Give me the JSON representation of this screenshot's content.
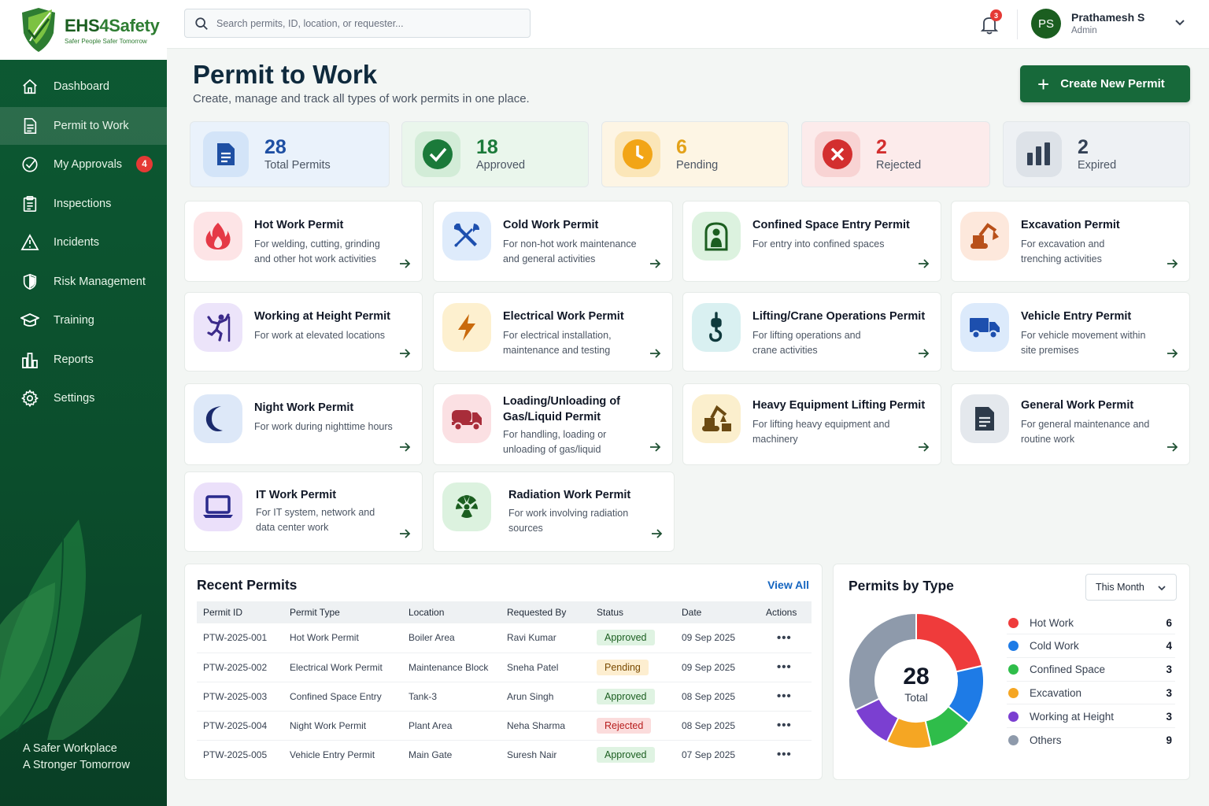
{
  "brand": {
    "name_a": "EHS",
    "name_b": "4Safety",
    "tagline_small": "Safer People  Safer Tomorrow"
  },
  "sidebar": {
    "items": [
      {
        "label": "Dashboard",
        "icon": "home-icon"
      },
      {
        "label": "Permit to Work",
        "icon": "document-icon",
        "active": true
      },
      {
        "label": "My Approvals",
        "icon": "check-circle-icon",
        "badge": "4"
      },
      {
        "label": "Inspections",
        "icon": "clipboard-icon"
      },
      {
        "label": "Incidents",
        "icon": "warning-icon"
      },
      {
        "label": "Risk Management",
        "icon": "shield-icon"
      },
      {
        "label": "Training",
        "icon": "graduation-cap-icon"
      },
      {
        "label": "Reports",
        "icon": "bar-chart-icon"
      },
      {
        "label": "Settings",
        "icon": "gear-icon"
      }
    ],
    "footer_line1": "A Safer Workplace",
    "footer_line2": "A Stronger Tomorrow"
  },
  "topbar": {
    "search_placeholder": "Search permits, ID, location, or requester...",
    "notification_count": "3",
    "user_initials": "PS",
    "user_name": "Prathamesh S",
    "user_role": "Admin"
  },
  "page": {
    "title": "Permit to Work",
    "subtitle": "Create, manage and track all types of work permits in one place.",
    "create_label": "Create New Permit"
  },
  "stats": [
    {
      "value": "28",
      "label": "Total Permits",
      "color": "#1e4fa3",
      "bg": "#eaf2fb",
      "icon": "document-icon"
    },
    {
      "value": "18",
      "label": "Approved",
      "color": "#1b7a3a",
      "bg": "#eaf6ec",
      "icon": "check-circle-icon"
    },
    {
      "value": "6",
      "label": "Pending",
      "color": "#e3a21a",
      "bg": "#fdf5e4",
      "icon": "clock-icon"
    },
    {
      "value": "2",
      "label": "Rejected",
      "color": "#d32f2f",
      "bg": "#fcebeb",
      "icon": "x-circle-icon"
    },
    {
      "value": "2",
      "label": "Expired",
      "color": "#334155",
      "bg": "#eef1f4",
      "icon": "bar-chart-icon"
    }
  ],
  "permit_types": [
    {
      "title": "Hot Work Permit",
      "desc": "For welding, cutting, grinding and other hot work activities",
      "icon": "flame-icon"
    },
    {
      "title": "Cold Work Permit",
      "desc": "For non-hot work maintenance and general activities",
      "icon": "tools-icon"
    },
    {
      "title": "Confined Space Entry Permit",
      "desc": "For entry into confined spaces",
      "icon": "confined-space-icon"
    },
    {
      "title": "Excavation Permit",
      "desc": "For excavation and trenching activities",
      "icon": "excavator-icon"
    },
    {
      "title": "Working at Height Permit",
      "desc": "For work at elevated locations",
      "icon": "climber-icon"
    },
    {
      "title": "Electrical Work Permit",
      "desc": "For electrical installation, maintenance and testing",
      "icon": "lightning-icon"
    },
    {
      "title": "Lifting/Crane Operations Permit",
      "desc": "For lifting operations and crane activities",
      "icon": "crane-hook-icon"
    },
    {
      "title": "Vehicle Entry Permit",
      "desc": "For vehicle movement within site premises",
      "icon": "truck-icon"
    },
    {
      "title": "Night Work Permit",
      "desc": "For work during nighttime hours",
      "icon": "moon-icon"
    },
    {
      "title": "Loading/Unloading of Gas/Liquid Permit",
      "desc": "For handling, loading or unloading of gas/liquid",
      "icon": "tanker-icon"
    },
    {
      "title": "Heavy Equipment Lifting Permit",
      "desc": "For lifting heavy equipment and machinery",
      "icon": "heavy-equipment-icon"
    },
    {
      "title": "General Work Permit",
      "desc": "For general maintenance and routine work",
      "icon": "document-icon"
    },
    {
      "title": "IT Work Permit",
      "desc": "For IT system, network and data center work",
      "icon": "laptop-icon"
    },
    {
      "title": "Radiation Work Permit",
      "desc": "For work involving radiation sources",
      "icon": "radiation-icon"
    }
  ],
  "recent": {
    "title": "Recent Permits",
    "view_all": "View All",
    "columns": [
      "Permit ID",
      "Permit Type",
      "Location",
      "Requested By",
      "Status",
      "Date",
      "Actions"
    ],
    "rows": [
      {
        "id": "PTW-2025-001",
        "type": "Hot Work Permit",
        "location": "Boiler Area",
        "by": "Ravi Kumar",
        "status": "Approved",
        "date": "09 Sep 2025"
      },
      {
        "id": "PTW-2025-002",
        "type": "Electrical Work Permit",
        "location": "Maintenance Block",
        "by": "Sneha Patel",
        "status": "Pending",
        "date": "09 Sep 2025"
      },
      {
        "id": "PTW-2025-003",
        "type": "Confined Space Entry",
        "location": "Tank-3",
        "by": "Arun Singh",
        "status": "Approved",
        "date": "08 Sep 2025"
      },
      {
        "id": "PTW-2025-004",
        "type": "Night Work Permit",
        "location": "Plant Area",
        "by": "Neha Sharma",
        "status": "Rejected",
        "date": "08 Sep 2025"
      },
      {
        "id": "PTW-2025-005",
        "type": "Vehicle Entry Permit",
        "location": "Main Gate",
        "by": "Suresh Nair",
        "status": "Approved",
        "date": "07 Sep 2025"
      }
    ],
    "actions_glyph": "•••"
  },
  "by_type": {
    "title": "Permits by Type",
    "period": "This Month",
    "total_value": "28",
    "total_label": "Total"
  },
  "chart_data": {
    "type": "pie",
    "title": "Permits by Type",
    "categories": [
      "Hot Work",
      "Cold Work",
      "Confined Space",
      "Excavation",
      "Working at Height",
      "Others"
    ],
    "values": [
      6,
      4,
      3,
      3,
      3,
      9
    ],
    "colors": [
      "#ef3b3b",
      "#1e7be6",
      "#2fbd4a",
      "#f5a623",
      "#7b3fd1",
      "#8e9aab"
    ],
    "donut": true
  }
}
